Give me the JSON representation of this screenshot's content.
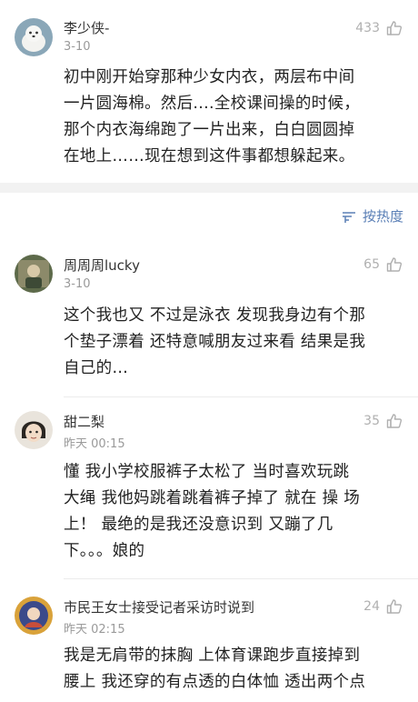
{
  "comments": [
    {
      "name": "李少侠-",
      "date": "3-10",
      "likes": "433",
      "lines": [
        "初中刚开始穿那种少女内衣，两层布中间",
        "一片圆海棉。然后....全校课间操的时候，",
        "那个内衣海绵跑了一片出来，白白圆圆掉",
        "在地上……现在想到这件事都想躲起来。"
      ]
    },
    {
      "name": "周周周lucky",
      "date": "3-10",
      "likes": "65",
      "lines": [
        "这个我也又 不过是泳衣 发现我身边有个那",
        "个垫子漂着 还特意喊朋友过来看 结果是我",
        "自己的…"
      ]
    },
    {
      "name": "甜二梨",
      "date": "昨天 00:15",
      "likes": "35",
      "lines": [
        "懂 我小学校服裤子太松了 当时喜欢玩跳",
        "大绳 我他妈跳着跳着裤子掉了 就在 操 场",
        "上！  最绝的是我还没意识到 又蹦了几",
        "下。。。娘的"
      ]
    },
    {
      "name": "市民王女士接受记者采访时说到",
      "date": "昨天 02:15",
      "likes": "24",
      "lines": [
        "我是无肩带的抹胸 上体育课跑步直接掉到",
        "腰上 我还穿的有点透的白体恤 透出两个点"
      ]
    }
  ],
  "sort_label": "按热度",
  "colors": {
    "link": "#5a7fb6",
    "meta": "#9a9a9a",
    "divider": "#f2f2f2"
  },
  "icons": [
    "thumbs-up-icon",
    "sort-icon"
  ]
}
